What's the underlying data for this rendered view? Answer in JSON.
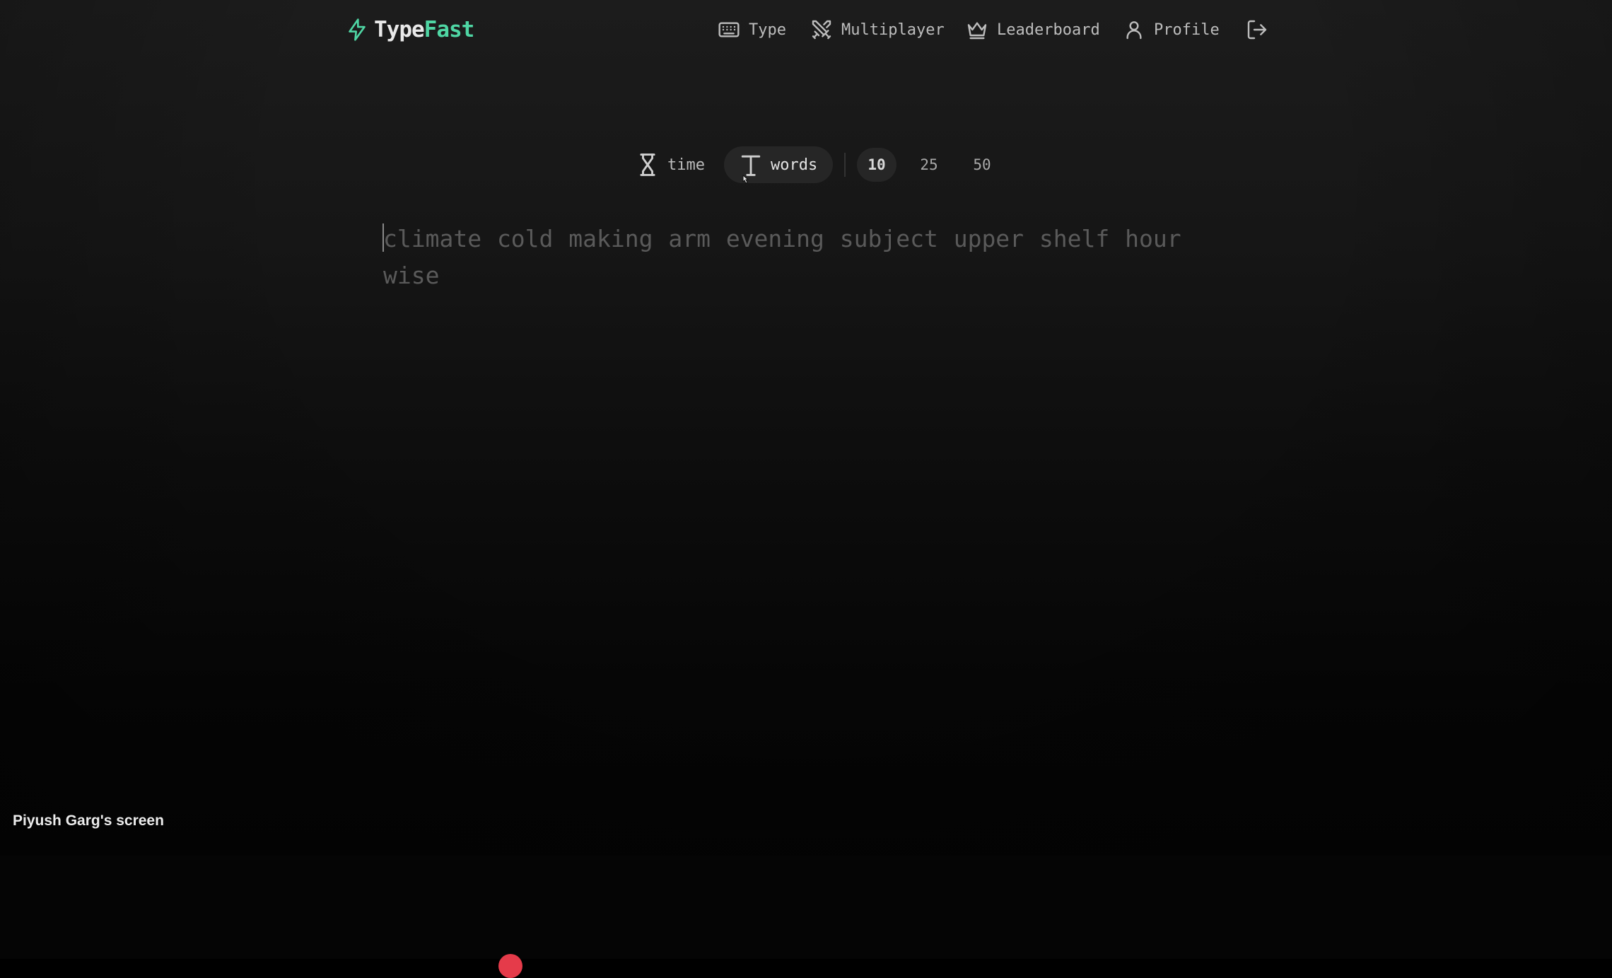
{
  "brand": {
    "part1": "Type",
    "part2": "Fast",
    "accent_color": "#4fd6a4",
    "icon": "bolt-icon"
  },
  "nav": {
    "type": {
      "label": "Type",
      "icon": "keyboard-icon"
    },
    "multiplayer": {
      "label": "Multiplayer",
      "icon": "swords-icon"
    },
    "leaderboard": {
      "label": "Leaderboard",
      "icon": "crown-icon"
    },
    "profile": {
      "label": "Profile",
      "icon": "user-icon"
    },
    "logout": {
      "icon": "logout-icon"
    }
  },
  "modes": {
    "time": {
      "label": "time",
      "icon": "hourglass-icon"
    },
    "words": {
      "label": "words",
      "icon": "text-icon",
      "selected": true
    }
  },
  "word_counts": [
    "10",
    "25",
    "50"
  ],
  "selected_count": "10",
  "test_text": "climate cold making arm evening subject upper shelf hour wise",
  "screen_share_label": "Piyush Garg's screen"
}
